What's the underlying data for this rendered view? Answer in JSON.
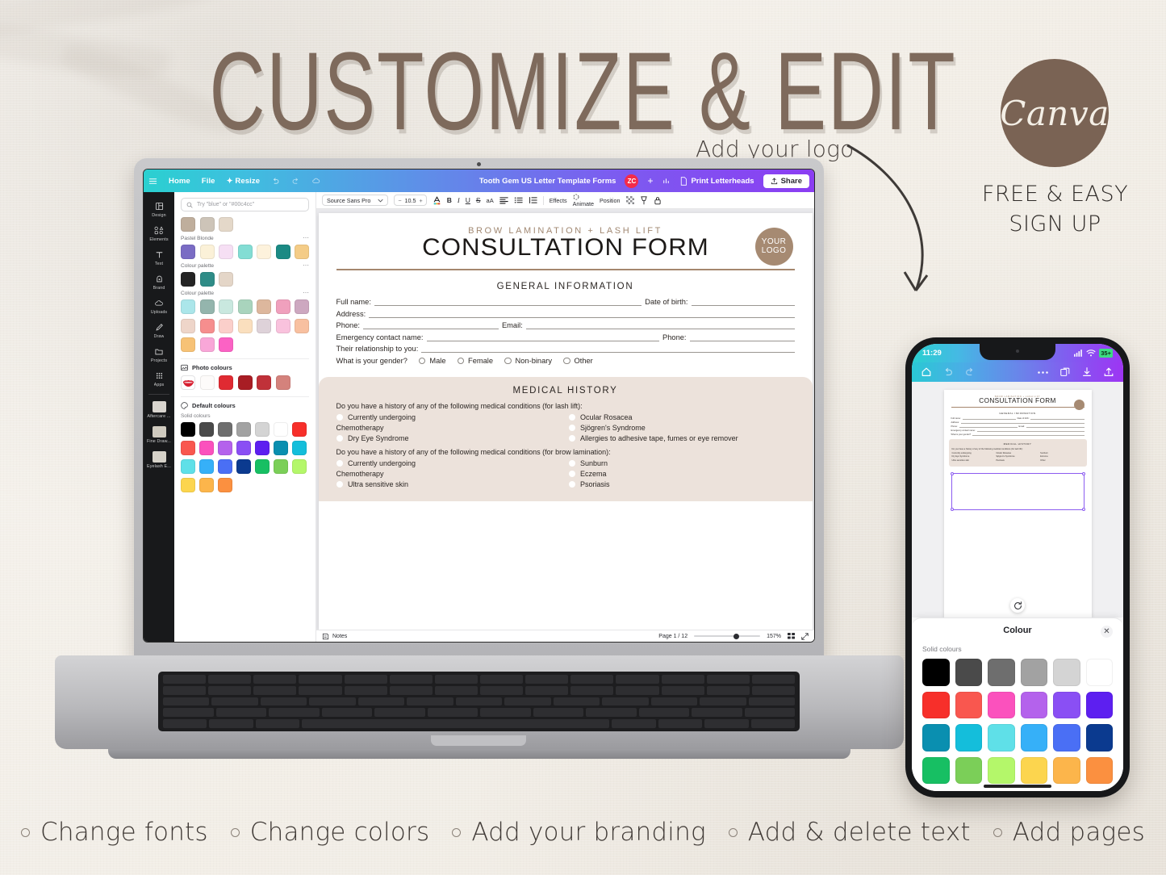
{
  "poster": {
    "headline": "CUSTOMIZE & EDIT",
    "logo_annotation": "Add your logo",
    "brand_badge": "Canva",
    "brand_sub_line1": "FREE & EASY",
    "brand_sub_line2": "SIGN UP",
    "features": [
      "Change fonts",
      "Change colors",
      "Add your branding",
      "Add & delete text",
      "Add pages"
    ],
    "brand_color": "#7a6354",
    "headline_color": "#7e6a5c",
    "paper_color": "#f3efe9"
  },
  "canva": {
    "topbar": {
      "menu_icon": "hamburger-icon",
      "items": [
        "Home",
        "File",
        "Resize"
      ],
      "undo_icon": "undo-icon",
      "redo_icon": "redo-icon",
      "cloud_icon": "cloud-sync-icon",
      "doc_title": "Tooth Gem US Letter Template Forms",
      "avatar_initials": "ZC",
      "avatar_color": "#f42b4a",
      "add_collaborator": "+",
      "insights_icon": "bar-chart-icon",
      "print_label": "Print Letterheads",
      "print_icon": "document-icon",
      "share_label": "Share",
      "share_icon": "upload-icon"
    },
    "sidebar": [
      {
        "label": "Design",
        "icon": "layout-icon"
      },
      {
        "label": "Elements",
        "icon": "shapes-icon"
      },
      {
        "label": "Text",
        "icon": "text-t-icon"
      },
      {
        "label": "Brand",
        "icon": "brand-badge-icon"
      },
      {
        "label": "Uploads",
        "icon": "cloud-upload-icon"
      },
      {
        "label": "Draw",
        "icon": "pen-icon"
      },
      {
        "label": "Projects",
        "icon": "folder-icon"
      },
      {
        "label": "Apps",
        "icon": "grid-dots-icon"
      },
      {
        "label": "Aftercare ...",
        "icon": "thumbnail-icon"
      },
      {
        "label": "Fine Draw...",
        "icon": "thumbnail-icon"
      },
      {
        "label": "Eyelash E...",
        "icon": "thumbnail-icon"
      }
    ],
    "color_panel": {
      "search_placeholder": "Try \"blue\" or \"#00c4cc\"",
      "search_icon": "search-icon",
      "document_colors": [
        "#b7a header",
        "#c9b9a8",
        "#cfc6ba",
        "#e3d7c8"
      ],
      "doc_row": [
        "#bfae9c",
        "#cdc4b8",
        "#e4d8c9"
      ],
      "groups": [
        {
          "label": "Pastel Blonde",
          "colors": [
            "#7a6cc4",
            "#fbf1d8",
            "#f6dff4",
            "#83ddd4",
            "#fdf2dc",
            "#1b8a84",
            "#f4cc87"
          ]
        },
        {
          "label": "Colour palette",
          "colors": [
            "#242424",
            "#2f8c87",
            "#e4d6c8"
          ]
        },
        {
          "label": "Colour palette",
          "colors": [
            "#abe6ea",
            "#94b5ad",
            "#c9e8df",
            "#a9d4bd",
            "#ddb79d",
            "#f0a0bd",
            "#cda8c0",
            "#eed5c9",
            "#f68e8e",
            "#fbcfca",
            "#fadfbe",
            "#ded2d9",
            "#f9c2dd",
            "#f8c0a0",
            "#f7c276",
            "#f9a7d8",
            "#fb62c4"
          ]
        }
      ],
      "photo_colors_label": "Photo colours",
      "photo_colors_icon": "image-icon",
      "photo_colors": [
        "lips-thumbnail",
        "#fdfbfa",
        "#e02a32",
        "#a81d24",
        "#c03139",
        "#d4827c"
      ],
      "default_colors_label": "Default colours",
      "default_colors_icon": "palette-icon",
      "solid_colors_label": "Solid colours",
      "solid_colors": [
        "#000000",
        "#4a4a4a",
        "#6e6e6e",
        "#a2a2a2",
        "#d4d4d4",
        "#ffffff",
        "#f72f2a",
        "#f9574f",
        "#fb51bd",
        "#b462ec",
        "#8a4ff4",
        "#5d1ff0",
        "#0a8fb0",
        "#14bedb",
        "#5fe0e8",
        "#36b0f8",
        "#4a6ff5",
        "#0b3a8f",
        "#17bf63",
        "#7bcf58",
        "#b4f76a",
        "#fcd54e",
        "#fcb54b",
        "#fb9040"
      ]
    },
    "toolbar": {
      "font_family": "Source Sans Pro",
      "font_size": "10.5",
      "minus": "−",
      "plus": "+",
      "text_color_icon": "text-color-a-icon",
      "bold": "B",
      "italic": "I",
      "underline": "U",
      "strike": "S",
      "case": "aA",
      "align_icon": "align-left-icon",
      "bullets_icon": "bullet-list-icon",
      "spacing_icon": "line-spacing-icon",
      "effects_label": "Effects",
      "animate_label": "Animate",
      "animate_icon": "animate-icon",
      "position_label": "Position",
      "transparency_icon": "transparency-icon",
      "duplicate_icon": "duplicate-icon",
      "lock_icon": "lock-icon"
    },
    "statusbar": {
      "notes_label": "Notes",
      "notes_icon": "notes-icon",
      "page_label": "Page 1 / 12",
      "zoom_label": "157%",
      "grid_icon": "grid-view-icon",
      "fullscreen_icon": "expand-icon"
    }
  },
  "form": {
    "kicker": "BROW LAMINATION + LASH LIFT",
    "title": "CONSULTATION FORM",
    "logo_line1": "YOUR",
    "logo_line2": "LOGO",
    "section_general": "GENERAL INFORMATION",
    "fields": [
      {
        "label": "Full name:",
        "label2": "Date of birth:"
      },
      {
        "label": "Address:"
      },
      {
        "label": "Phone:",
        "label2": "Email:"
      },
      {
        "label": "Emergency contact name:",
        "label2": "Phone:"
      },
      {
        "label": "Their relationship to you:"
      }
    ],
    "gender_question": "What is your gender?",
    "gender_options": [
      "Male",
      "Female",
      "Non-binary",
      "Other"
    ],
    "section_medical": "MEDICAL HISTORY",
    "medical_q1": "Do you have a history of any of the following medical conditions (for lash lift):",
    "medical_list1_left": [
      "Currently undergoing",
      "Chemotherapy",
      "Dry Eye Syndrome"
    ],
    "medical_list1_right": [
      "Ocular Rosacea",
      "Sjögren's Syndrome",
      "Allergies to adhesive tape, fumes or eye remover"
    ],
    "medical_q2": "Do you have a history of any of the following medical conditions (for brow lamination):",
    "medical_list2_left": [
      "Currently undergoing",
      "Chemotherapy",
      "Ultra sensitive skin"
    ],
    "medical_list2_right": [
      "Sunburn",
      "Eczema",
      "Psoriasis"
    ],
    "accent_color": "#a5876e",
    "panel_color": "#ece2db"
  },
  "phone": {
    "time": "11:29",
    "signal_icon": "signal-bars-icon",
    "wifi_icon": "wifi-icon",
    "battery_label": "35+",
    "toolbar": {
      "home_icon": "home-icon",
      "undo_icon": "undo-icon",
      "redo_icon": "redo-icon",
      "more_icon": "more-dots-icon",
      "pages_icon": "pages-icon",
      "download_icon": "download-icon",
      "share_icon": "upload-icon"
    },
    "refresh_icon": "refresh-icon",
    "sheet": {
      "title": "Colour",
      "close_icon": "close-icon",
      "solid_label": "Solid colours",
      "colors": [
        "#000000",
        "#4a4a4a",
        "#6e6e6e",
        "#a2a2a2",
        "#d4d4d4",
        "#ffffff",
        "#f72f2a",
        "#f9574f",
        "#fb51bd",
        "#b462ec",
        "#8a4ff4",
        "#5d1ff0",
        "#0a8fb0",
        "#14bedb",
        "#5fe0e8",
        "#36b0f8",
        "#4a6ff5",
        "#0b3a8f",
        "#17bf63",
        "#7bcf58",
        "#b4f76a",
        "#fcd54e",
        "#fcb54b",
        "#fb9040"
      ]
    }
  }
}
